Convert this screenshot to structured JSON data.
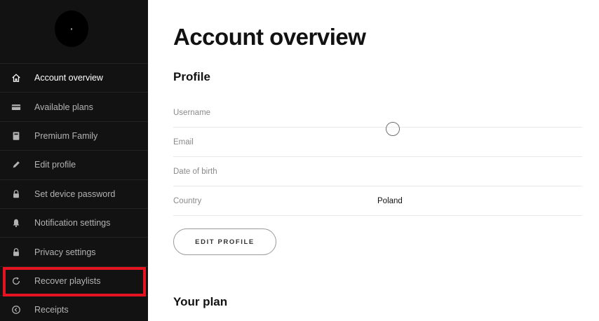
{
  "sidebar": {
    "items": [
      {
        "label": "Account overview",
        "icon": "home-icon",
        "active": true
      },
      {
        "label": "Available plans",
        "icon": "card-icon"
      },
      {
        "label": "Premium Family",
        "icon": "device-icon"
      },
      {
        "label": "Edit profile",
        "icon": "pencil-icon"
      },
      {
        "label": "Set device password",
        "icon": "lock-icon"
      },
      {
        "label": "Notification settings",
        "icon": "bell-icon"
      },
      {
        "label": "Privacy settings",
        "icon": "lock-icon"
      },
      {
        "label": "Recover playlists",
        "icon": "refresh-icon"
      },
      {
        "label": "Receipts",
        "icon": "receipt-icon"
      }
    ]
  },
  "main": {
    "title": "Account overview",
    "profile": {
      "heading": "Profile",
      "rows": [
        {
          "label": "Username",
          "value": ""
        },
        {
          "label": "Email",
          "value": ""
        },
        {
          "label": "Date of birth",
          "value": ""
        },
        {
          "label": "Country",
          "value": "Poland"
        }
      ],
      "edit_button": "EDIT PROFILE"
    },
    "plan": {
      "heading": "Your plan"
    }
  },
  "colors": {
    "sidebar_bg": "#121212",
    "highlight": "#e5131f",
    "text": "#121212"
  }
}
